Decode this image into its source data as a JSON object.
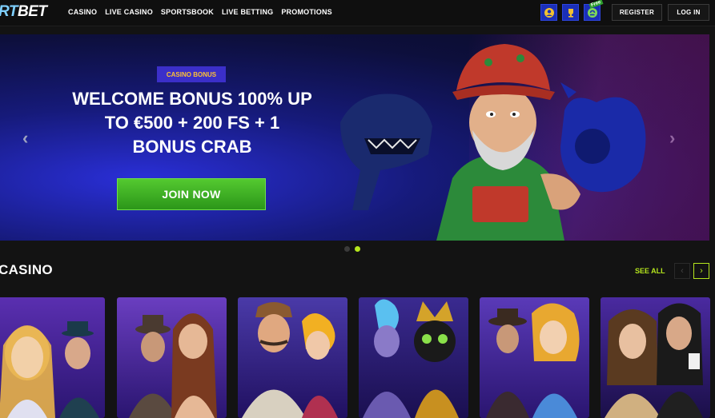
{
  "header": {
    "logo_left": "RT",
    "logo_right": "BET",
    "nav": [
      "CASINO",
      "LIVE CASINO",
      "SPORTSBOOK",
      "LIVE BETTING",
      "PROMOTIONS"
    ],
    "icons": [
      "user-profile-icon",
      "trophy-icon",
      "free-spin-icon"
    ],
    "free_badge": "Free",
    "register_label": "REGISTER",
    "login_label": "LOG IN"
  },
  "hero": {
    "badge": "CASINO BONUS",
    "title": "WELCOME BONUS 100% UP TO €500 + 200 FS + 1 BONUS CRAB",
    "cta": "JOIN NOW",
    "prev_arrow": "‹",
    "next_arrow": "›",
    "slides_total": 2,
    "slide_active": 2
  },
  "casino": {
    "title": "CASINO",
    "see_all": "SEE ALL",
    "prev": "‹",
    "next": "›",
    "games": [
      "game-tile-1",
      "game-tile-2",
      "game-tile-3",
      "game-tile-4",
      "game-tile-5",
      "game-tile-6"
    ]
  },
  "colors": {
    "accent": "#b5e61d",
    "cta_green": "#3cb323",
    "badge_bg": "#3b2fc9",
    "badge_text": "#ffc233",
    "icon_blue": "#1b2fb8"
  }
}
